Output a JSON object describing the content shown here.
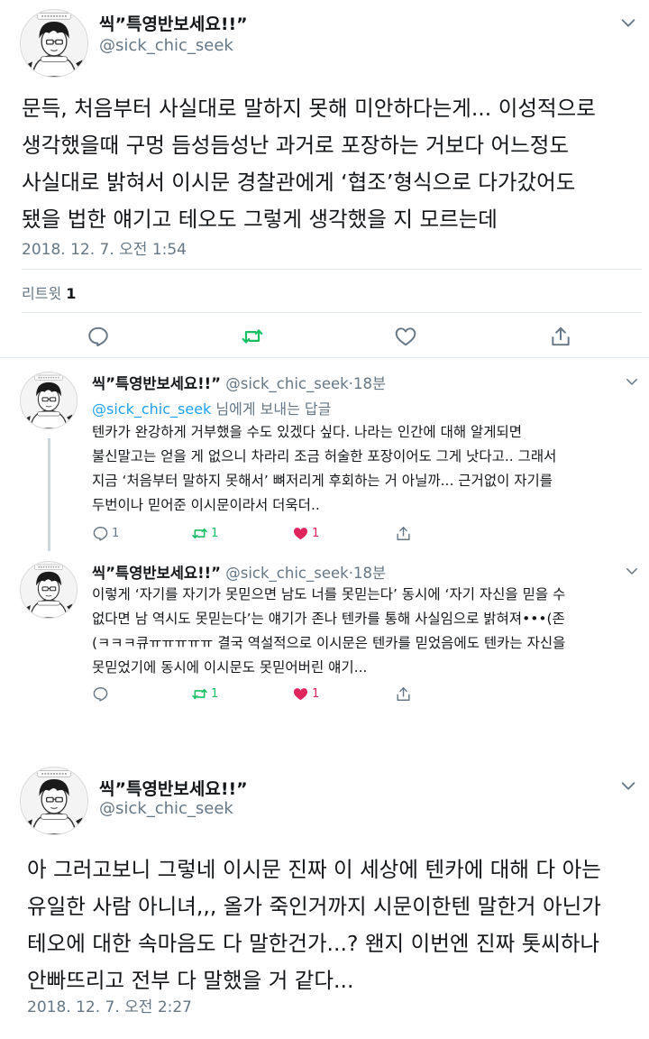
{
  "account": {
    "display_name": "씩”특영반보세요!!”",
    "handle": "@sick_chic_seek",
    "avatar_icon": "anime-boy-avatar-icon"
  },
  "tweet_1": {
    "text": "문득, 처음부터 사실대로 말하지 못해 미안하다는게... 이성적으로\n생각했을때 구멍 듬성듬성난 과거로 포장하는 거보다 어느정도\n사실대로 밝혀서 이시문 경찰관에게 ‘협조’형식으로 다가갔어도\n됐을 법한 얘기고 테오도 그렇게 생각했을 지 모르는데",
    "timestamp": "2018. 12. 7. 오전 1:54",
    "retweet_label": "리트윗",
    "retweet_count": "1",
    "actions": [
      "reply-icon",
      "retweet-icon",
      "like-icon",
      "share-icon"
    ]
  },
  "replies": [
    {
      "display_name": "씩”특영반보세요!!”",
      "handle": "@sick_chic_seek",
      "separator": "·",
      "time": "18분",
      "replying_to_handle": "@sick_chic_seek",
      "replying_to_suffix": " 님에게 보내는 답글",
      "text": "텐카가 완강하게 거부했을 수도 있겠다 싶다. 나라는 인간에 대해 알게되면\n불신말고는 얻을 게 없으니 차라리 조금 허술한 포장이어도 그게 낫다고.. 그래서\n지금 ‘처음부터 말하지 못해서’ 뼈저리게 후회하는 거 아닐까... 근거없이 자기를\n두번이나 믿어준 이시문이라서 더욱더..",
      "reply_count": "1",
      "retweet_count": "1",
      "like_count": "1"
    },
    {
      "display_name": "씩”특영반보세요!!”",
      "handle": "@sick_chic_seek",
      "separator": "·",
      "time": "18분",
      "text": "이렇게 ‘자기를 자기가 못믿으면 남도 너를 못믿는다’ 동시에 ‘자기 자신을 믿을 수\n없다면 남 역시도 못믿는다’는 얘기가 존나 텐카를 통해 사실임으로 밝혀져•••(존\n(ㅋㅋㅋ큐ㅠㅠㅠㅠㅠ 결국 역설적으로 이시문은 텐카를 믿었음에도 텐카는 자신을\n못믿었기에 동시에 이시문도 못믿어버린 얘기...",
      "reply_count": "",
      "retweet_count": "1",
      "like_count": "1"
    }
  ],
  "tweet_2": {
    "text": "아 그러고보니 그렇네 이시문 진짜 이 세상에 텐카에 대해 다 아는\n유일한 사람 아니녀,,, 올가 죽인거까지 시문이한텐 말한거 아닌가\n테오에 대한 속마음도 다 말한건가...? 왠지 이번엔 진짜 톳씨하나\n안빠뜨리고 전부 다 말했을 거 같다...",
    "timestamp": "2018. 12. 7. 오전 2:27"
  },
  "colors": {
    "text": "#14171a",
    "secondary": "#657786",
    "link": "#1da1f2",
    "retweet": "#17bf63",
    "like": "#e0245e",
    "border": "#e1e8ed"
  }
}
